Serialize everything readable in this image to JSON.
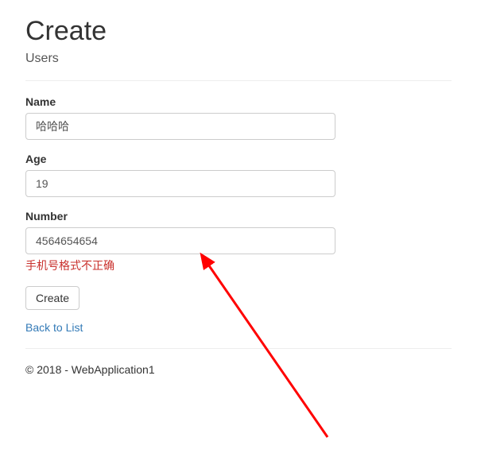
{
  "header": {
    "title": "Create",
    "subtitle": "Users"
  },
  "form": {
    "name": {
      "label": "Name",
      "value": "哈哈哈"
    },
    "age": {
      "label": "Age",
      "value": "19"
    },
    "number": {
      "label": "Number",
      "value": "4564654654",
      "error": "手机号格式不正确"
    },
    "submit_label": "Create"
  },
  "links": {
    "back": "Back to List"
  },
  "footer": {
    "text": "© 2018 - WebApplication1"
  },
  "annotation": {
    "color": "#ff0000"
  }
}
